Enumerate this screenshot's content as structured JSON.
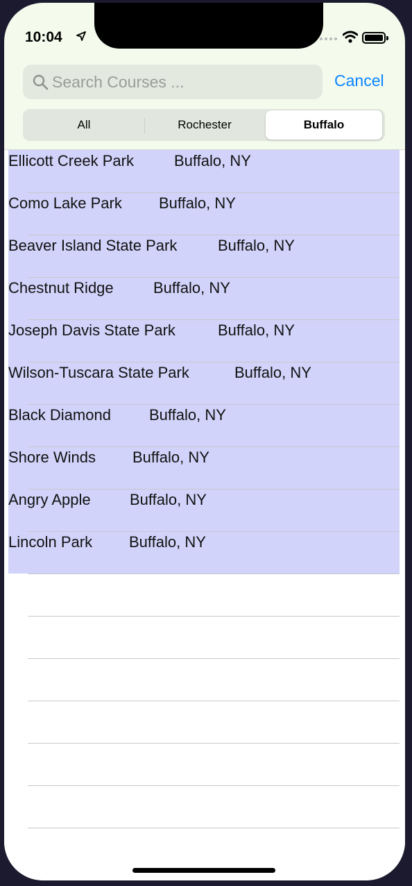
{
  "status_bar": {
    "time": "10:04"
  },
  "search": {
    "placeholder": "Search Courses ...",
    "value": "",
    "cancel_label": "Cancel"
  },
  "filter": {
    "segments": [
      {
        "label": "All"
      },
      {
        "label": "Rochester"
      },
      {
        "label": "Buffalo"
      }
    ],
    "selected": "Buffalo"
  },
  "courses": [
    {
      "name": "Ellicott Creek Park",
      "city": "Buffalo, NY"
    },
    {
      "name": "Como Lake Park",
      "city": "Buffalo, NY"
    },
    {
      "name": "Beaver Island State Park",
      "city": "Buffalo, NY"
    },
    {
      "name": "Chestnut Ridge",
      "city": "Buffalo, NY"
    },
    {
      "name": "Joseph Davis State Park",
      "city": "Buffalo, NY"
    },
    {
      "name": "Wilson-Tuscara State Park",
      "city": "Buffalo, NY"
    },
    {
      "name": "Black Diamond",
      "city": "Buffalo, NY"
    },
    {
      "name": "Shore Winds",
      "city": "Buffalo, NY"
    },
    {
      "name": "Angry Apple",
      "city": "Buffalo, NY"
    },
    {
      "name": "Lincoln Park",
      "city": "Buffalo, NY"
    }
  ],
  "colors": {
    "accent": "#0a84ff",
    "row_highlight": "#d1d3fa",
    "background": "#f4faec"
  }
}
